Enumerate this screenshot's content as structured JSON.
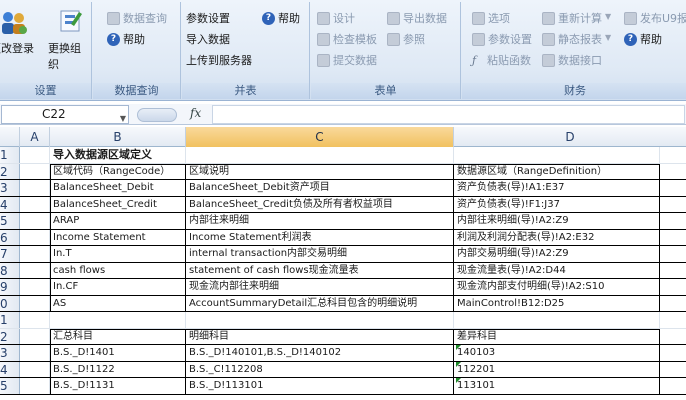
{
  "ribbon": {
    "setup": {
      "label": "设置",
      "change_login": "更改登录",
      "change_org": "更换组织"
    },
    "data_query": {
      "label": "数据查询",
      "query": "数据查询",
      "help": "帮助"
    },
    "merge": {
      "label": "并表",
      "param_settings": "参数设置",
      "help": "帮助",
      "import_data": "导入数据",
      "upload": "上传到服务器"
    },
    "report": {
      "label": "表单",
      "design": "设计",
      "export_data": "导出数据",
      "check_template": "检查模板",
      "reference": "参照",
      "submit_data": "提交数据"
    },
    "finance": {
      "label": "财务",
      "options": "选项",
      "recalc": "重新计算",
      "publish": "发布U9报",
      "param_settings": "参数设置",
      "static_report": "静态报表",
      "help": "帮助",
      "paste_function": "粘贴函数",
      "data_interface": "数据接口"
    }
  },
  "formula_bar": {
    "name_box": "C22",
    "fx": "fx",
    "formula": ""
  },
  "grid": {
    "columns": [
      "A",
      "B",
      "C",
      "D"
    ],
    "selected_column": "C",
    "rows": [
      {
        "n": "1",
        "b": "导入数据源区域定义",
        "c": "",
        "d": ""
      },
      {
        "n": "2",
        "b": "区域代码（RangeCode）",
        "c": "区域说明",
        "d": "数据源区域（RangeDefinition）"
      },
      {
        "n": "3",
        "b": "BalanceSheet_Debit",
        "c": "BalanceSheet_Debit资产项目",
        "d": "资产负债表(导)!A1:E37"
      },
      {
        "n": "4",
        "b": "BalanceSheet_Credit",
        "c": "BalanceSheet_Credit负债及所有者权益项目",
        "d": "资产负债表(导)!F1:J37"
      },
      {
        "n": "5",
        "b": "ARAP",
        "c": "内部往来明细",
        "d": "内部往来明细(导)!A2:Z9"
      },
      {
        "n": "6",
        "b": "Income Statement",
        "c": "Income Statement利润表",
        "d": "利润及利润分配表(导)!A2:E32"
      },
      {
        "n": "7",
        "b": "In.T",
        "c": "internal transaction内部交易明细",
        "d": "内部交易明细(导)!A2:Z9"
      },
      {
        "n": "8",
        "b": "cash flows",
        "c": "statement of cash flows现金流量表",
        "d": "现金流量表(导)!A2:D44"
      },
      {
        "n": "9",
        "b": "In.CF",
        "c": "现金流内部往来明细",
        "d": "现金流内部支付明细(导)!A2:S10"
      },
      {
        "n": "0",
        "b": "AS",
        "c": "AccountSummaryDetail汇总科目包含的明细说明",
        "d": "MainControl!B12:D25"
      },
      {
        "n": "1",
        "b": "",
        "c": "",
        "d": ""
      },
      {
        "n": "2",
        "b": "汇总科目",
        "c": "明细科目",
        "d": "差异科目"
      },
      {
        "n": "3",
        "b": "B.S._D!1401",
        "c": "B.S._D!140101,B.S._D!140102",
        "d": "140103"
      },
      {
        "n": "4",
        "b": "B.S._D!1122",
        "c": "B.S._C!112208",
        "d": "112201"
      },
      {
        "n": "5",
        "b": "B.S._D!1131",
        "c": "B.S._D!113101",
        "d": "113101"
      }
    ]
  },
  "colors": {
    "ribbon_bg": "#dfe9f5",
    "selected_header": "#f1c15f",
    "grid_line": "#dde4ec",
    "accent_blue": "#2f63b8"
  }
}
